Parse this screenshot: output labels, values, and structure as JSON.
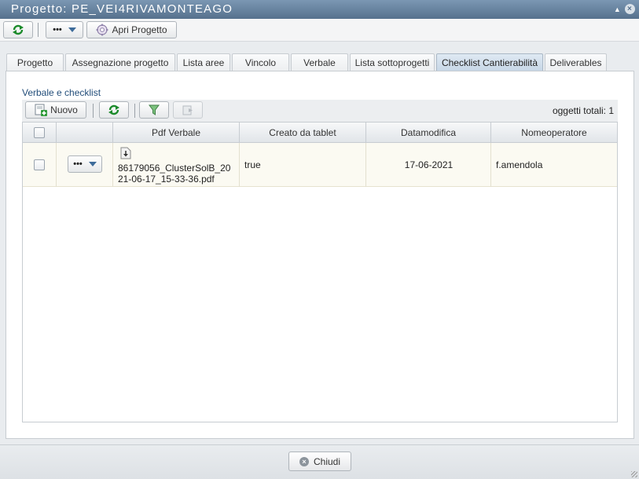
{
  "window": {
    "title": "Progetto: PE_VEI4RIVAMONTEAGO",
    "minimize_icon": "caret-up-icon",
    "close_icon": "close-icon"
  },
  "toolbar": {
    "more_label": "•••",
    "open_project_label": "Apri Progetto"
  },
  "tabs": [
    {
      "label": "Progetto",
      "active": false
    },
    {
      "label": "Assegnazione progetto",
      "active": false
    },
    {
      "label": "Lista aree",
      "active": false
    },
    {
      "label": "Vincolo",
      "active": false
    },
    {
      "label": "Verbale",
      "active": false
    },
    {
      "label": "Lista sottoprogetti",
      "active": false
    },
    {
      "label": "Checklist Cantierabilità",
      "active": true
    },
    {
      "label": "Deliverables",
      "active": false
    }
  ],
  "section": {
    "title": "Verbale e checklist"
  },
  "grid_toolbar": {
    "new_label": "Nuovo",
    "count_label": "oggetti totali: 1"
  },
  "grid": {
    "columns": [
      "Pdf Verbale",
      "Creato da tablet",
      "Datamodifica",
      "Nomeoperatore"
    ],
    "rows": [
      {
        "actions_label": "•••",
        "pdf_line1": "86179056_ClusterSolB_20",
        "pdf_line2": "21-06-17_15-33-36.pdf",
        "creato_da_tablet": "true",
        "datamodifica": "17-06-2021",
        "nomeoperatore": "f.amendola"
      }
    ]
  },
  "footer": {
    "close_label": "Chiudi"
  },
  "colors": {
    "titlebar": "#56718d",
    "accent": "#234e7a",
    "refresh_green": "#1b8a2a"
  }
}
